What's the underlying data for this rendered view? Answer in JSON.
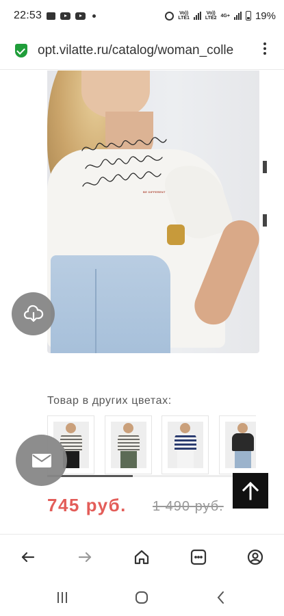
{
  "status_bar": {
    "time": "22:53",
    "battery": "19%",
    "volte1": "Vo))\nLTE1",
    "volte2": "Vo))\nLTE2",
    "network": "4G+"
  },
  "browser": {
    "url": "opt.vilatte.ru/catalog/woman_colle"
  },
  "product": {
    "print_label": "BE DIFFERENT",
    "other_colors_title": "Товар в других цветах:",
    "color_variants": [
      {
        "icon": "striped-beige-tee"
      },
      {
        "icon": "striped-brown-tee"
      },
      {
        "icon": "striped-navy-tee"
      },
      {
        "icon": "black-tee"
      }
    ],
    "color_variants_scroll_fraction": 0.41,
    "price": "745 руб.",
    "old_price": "1 490 руб."
  },
  "colors": {
    "price": "#e35d59",
    "secure": "#1f9d3a",
    "fab": "#878787",
    "scroll_top": "#111111"
  },
  "icons": {
    "download_fab": "cloud-download-icon",
    "mail_fab": "mail-icon",
    "scroll_top": "arrow-up-icon",
    "nav": [
      "back-arrow-icon",
      "forward-arrow-icon",
      "home-icon",
      "tabs-icon",
      "account-icon"
    ],
    "system": [
      "recents-icon",
      "home-circle-icon",
      "back-chevron-icon"
    ]
  }
}
